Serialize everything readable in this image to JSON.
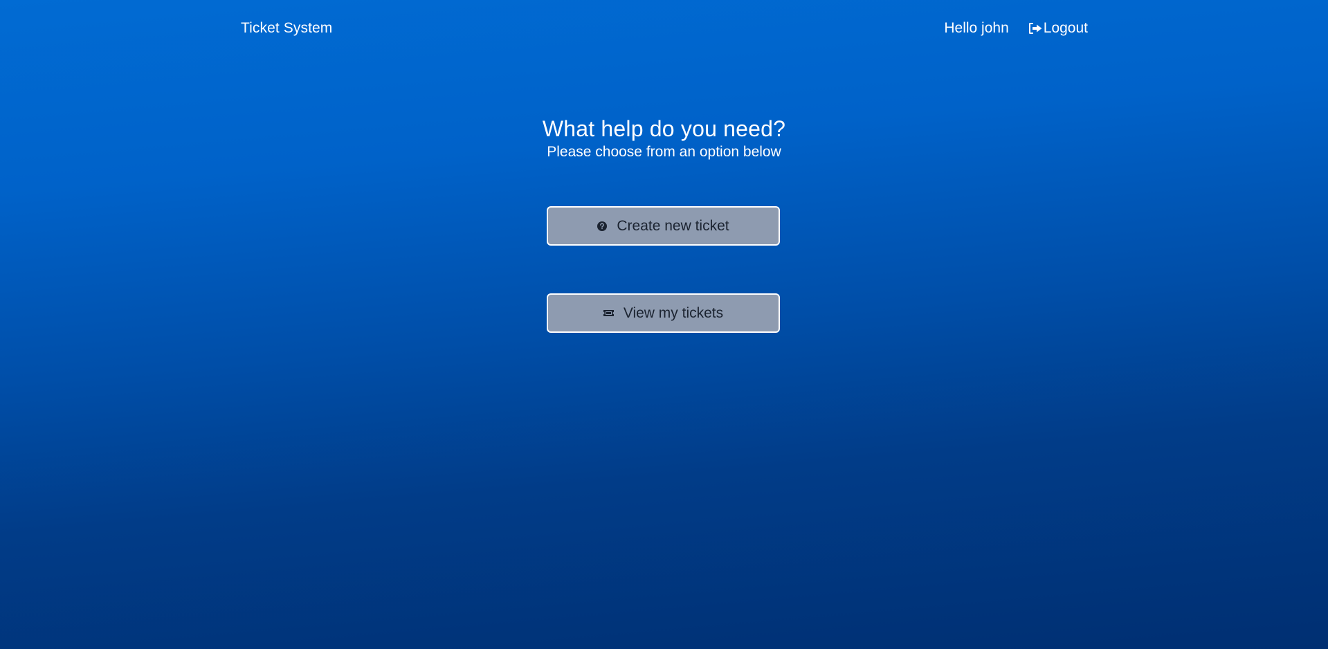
{
  "navbar": {
    "brand": "Ticket System",
    "greeting": "Hello john",
    "logout_label": "Logout",
    "logout_icon": "sign-out-icon"
  },
  "main": {
    "title": "What help do you need?",
    "subtitle": "Please choose from an option below",
    "actions": [
      {
        "label": "Create new ticket",
        "icon": "question-circle-icon"
      },
      {
        "label": "View my tickets",
        "icon": "ticket-icon"
      }
    ]
  },
  "colors": {
    "background_top": "#016bd3",
    "background_bottom": "#002f72",
    "button_bg": "#8e9bb0",
    "button_border": "#ffffff",
    "button_text": "#1b2330",
    "text": "#ffffff"
  }
}
